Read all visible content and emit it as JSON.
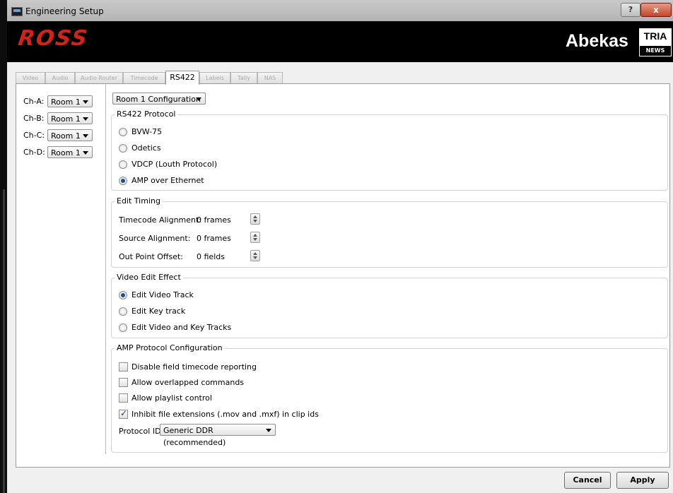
{
  "window": {
    "title": "Engineering Setup",
    "help_label": "?",
    "close_label": "x"
  },
  "banner": {
    "ross_logo": "ROSS",
    "abekas_logo": "Abekas",
    "tria_logo": "TRIA",
    "tria_sub": "NEWS"
  },
  "tabs": [
    {
      "label": "Video"
    },
    {
      "label": "Audio"
    },
    {
      "label": "Audio Router"
    },
    {
      "label": "Timecode"
    },
    {
      "label": "RS422",
      "active": true
    },
    {
      "label": "Labels"
    },
    {
      "label": "Tally"
    },
    {
      "label": "NAS"
    }
  ],
  "channels": [
    {
      "label": "Ch-A:",
      "value": "Room 1"
    },
    {
      "label": "Ch-B:",
      "value": "Room 1"
    },
    {
      "label": "Ch-C:",
      "value": "Room 1"
    },
    {
      "label": "Ch-D:",
      "value": "Room 1"
    }
  ],
  "config_select": {
    "value": "Room 1 Configuration"
  },
  "rs422_protocol": {
    "title": "RS422 Protocol",
    "options": [
      {
        "label": "BVW-75",
        "selected": false
      },
      {
        "label": "Odetics",
        "selected": false
      },
      {
        "label": "VDCP (Louth Protocol)",
        "selected": false
      },
      {
        "label": "AMP over Ethernet",
        "selected": true
      }
    ]
  },
  "edit_timing": {
    "title": "Edit Timing",
    "rows": [
      {
        "label": "Timecode Alignment:",
        "value": "0 frames"
      },
      {
        "label": "Source Alignment:",
        "value": "0 frames"
      },
      {
        "label": "Out Point Offset:",
        "value": "0 fields"
      }
    ]
  },
  "video_edit_effect": {
    "title": "Video Edit Effect",
    "options": [
      {
        "label": "Edit Video Track",
        "selected": true
      },
      {
        "label": "Edit Key track",
        "selected": false
      },
      {
        "label": "Edit Video and Key Tracks",
        "selected": false
      }
    ]
  },
  "amp_config": {
    "title": "AMP Protocol Configuration",
    "checks": [
      {
        "label": "Disable field timecode reporting",
        "checked": false
      },
      {
        "label": "Allow overlapped commands",
        "checked": false
      },
      {
        "label": "Allow playlist control",
        "checked": false
      },
      {
        "label": "Inhibit file extensions (.mov and .mxf) in clip ids",
        "checked": true
      }
    ],
    "protocol_id_label": "Protocol ID:",
    "protocol_id_value": "Generic DDR (recommended)"
  },
  "buttons": {
    "cancel": "Cancel",
    "apply": "Apply"
  },
  "colors": {
    "accent_red": "#d2221a",
    "selected_dot": "#1f4e8c"
  }
}
